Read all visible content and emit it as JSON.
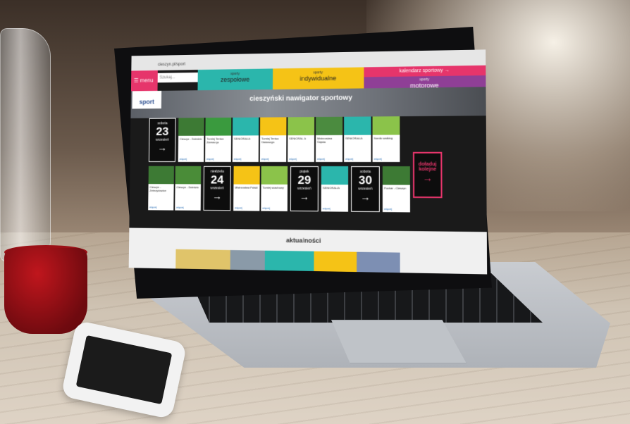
{
  "browser": {
    "url": "cieszyn.pl/sport"
  },
  "nav": {
    "menu_label": "menu",
    "search_placeholder": "Szukaj...",
    "tabs": [
      {
        "small": "sporty",
        "label": "zespołowe"
      },
      {
        "small": "sporty",
        "label": "indywidualne"
      },
      {
        "small": "sporty",
        "label": "motorowe"
      }
    ],
    "calendar_button": "kalendarz sportowy"
  },
  "logo": {
    "text": "sport"
  },
  "hero": {
    "title": "cieszyński nawigator sportowy"
  },
  "days": [
    {
      "name": "sobota",
      "num": "23",
      "month": "wrzesień",
      "arrow": "→"
    },
    {
      "name": "niedziela",
      "num": "24",
      "month": "wrzesień",
      "arrow": "→"
    },
    {
      "name": "piątek",
      "num": "29",
      "month": "wrzesień",
      "arrow": "→"
    },
    {
      "name": "sobota",
      "num": "30",
      "month": "wrzesień",
      "arrow": "→"
    }
  ],
  "events": [
    {
      "title": "Cieszyn - Dziedzic",
      "more": "więcej"
    },
    {
      "title": "Turniej Tenisa Ziemnego",
      "more": "więcej"
    },
    {
      "title": "SENIORALIA",
      "more": "więcej"
    },
    {
      "title": "Turniej Tenisa Stołowego",
      "more": "więcej"
    },
    {
      "title": "SENIORALIA",
      "more": "więcej"
    },
    {
      "title": "Mistrzostwa Śląska",
      "more": "więcej"
    },
    {
      "title": "SENIORALIA",
      "more": "więcej"
    },
    {
      "title": "Nordic walking",
      "more": "więcej"
    },
    {
      "title": "Cieszyn - Zebrzydowice",
      "more": "więcej"
    },
    {
      "title": "Cieszyn - Dziedzic",
      "more": "więcej"
    },
    {
      "title": "Mistrzostwa Polski",
      "more": "więcej"
    },
    {
      "title": "Turniej szachowy",
      "more": "więcej"
    },
    {
      "title": "Puchar - Cieszyn",
      "more": "więcej"
    }
  ],
  "more_button": {
    "label": "doładuj kolejne",
    "arrow": "→"
  },
  "news": {
    "title": "aktualności"
  },
  "colors": {
    "pink": "#e6356b",
    "teal": "#2bb6ac",
    "yellow": "#f5c316",
    "purple": "#8f3f96"
  }
}
